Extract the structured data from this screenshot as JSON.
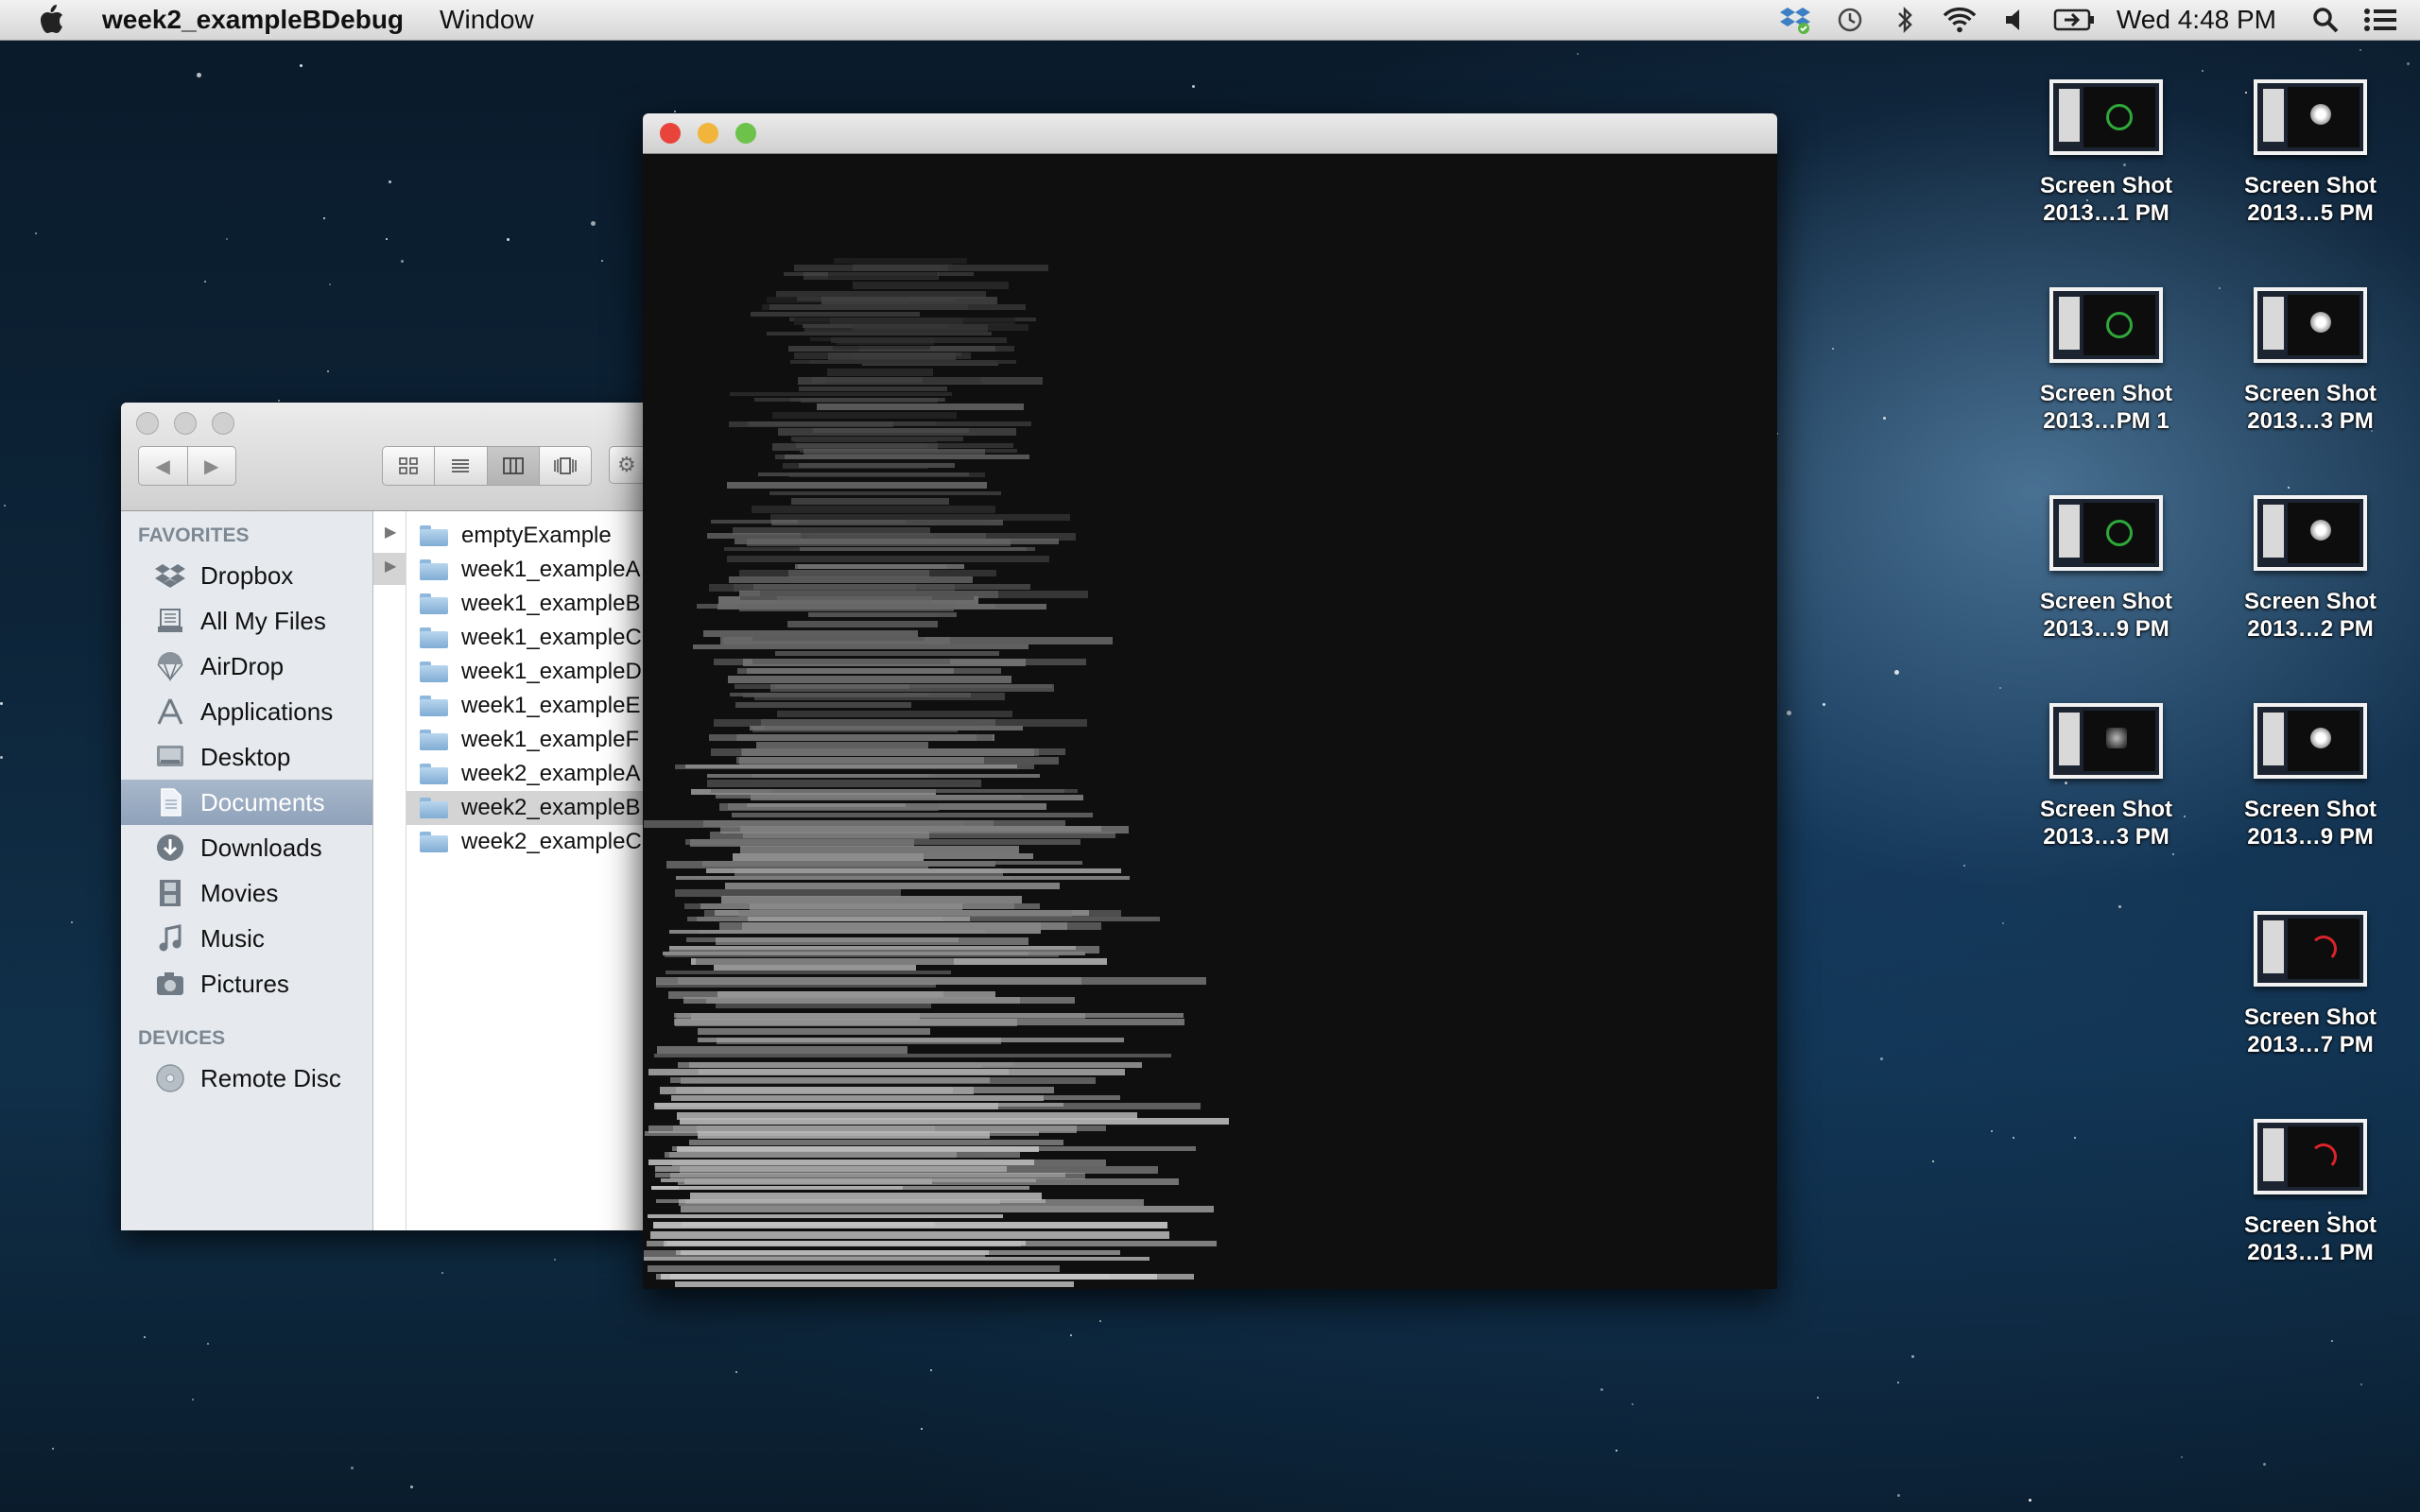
{
  "menubar": {
    "app_name": "week2_exampleBDebug",
    "items": [
      "Window"
    ],
    "clock": "Wed 4:48 PM",
    "status_icons": [
      "dropbox-icon",
      "time-machine-icon",
      "bluetooth-icon",
      "wifi-icon",
      "volume-icon",
      "battery-icon"
    ]
  },
  "desktop_icons": [
    {
      "line1": "Screen Shot",
      "line2": "2013…1 PM",
      "mark": "green-ring"
    },
    {
      "line1": "Screen Shot",
      "line2": "2013…5 PM",
      "mark": "white-swirl"
    },
    {
      "line1": "Screen Shot",
      "line2": "2013…PM 1",
      "mark": "green-ring"
    },
    {
      "line1": "Screen Shot",
      "line2": "2013…3 PM",
      "mark": "white-swirl"
    },
    {
      "line1": "Screen Shot",
      "line2": "2013…9 PM",
      "mark": "green-ring"
    },
    {
      "line1": "Screen Shot",
      "line2": "2013…2 PM",
      "mark": "white-swirl"
    },
    {
      "line1": "Screen Shot",
      "line2": "2013…3 PM",
      "mark": "gray-blur"
    },
    {
      "line1": "Screen Shot",
      "line2": "2013…9 PM",
      "mark": "white-swirl"
    },
    {
      "line1": "Screen Shot",
      "line2": "2013…7 PM",
      "mark": "red-arc"
    },
    {
      "line1": "Screen Shot",
      "line2": "2013…1 PM",
      "mark": "red-arc"
    }
  ],
  "finder": {
    "favorites_header": "FAVORITES",
    "favorites": [
      "Dropbox",
      "All My Files",
      "AirDrop",
      "Applications",
      "Desktop",
      "Documents",
      "Downloads",
      "Movies",
      "Music",
      "Pictures"
    ],
    "selected_favorite": "Documents",
    "devices_header": "DEVICES",
    "devices": [
      "Remote Disc"
    ],
    "files": [
      "emptyExample",
      "week1_exampleA",
      "week1_exampleB",
      "week1_exampleC",
      "week1_exampleD",
      "week1_exampleE",
      "week1_exampleF",
      "week2_exampleA",
      "week2_exampleB",
      "week2_exampleC"
    ],
    "selected_file": "week2_exampleB"
  },
  "colors": {
    "close": "#e9443c",
    "minimize": "#f0b53a",
    "zoom": "#6cc24a",
    "sidebar_selected": "#98a9bf"
  }
}
